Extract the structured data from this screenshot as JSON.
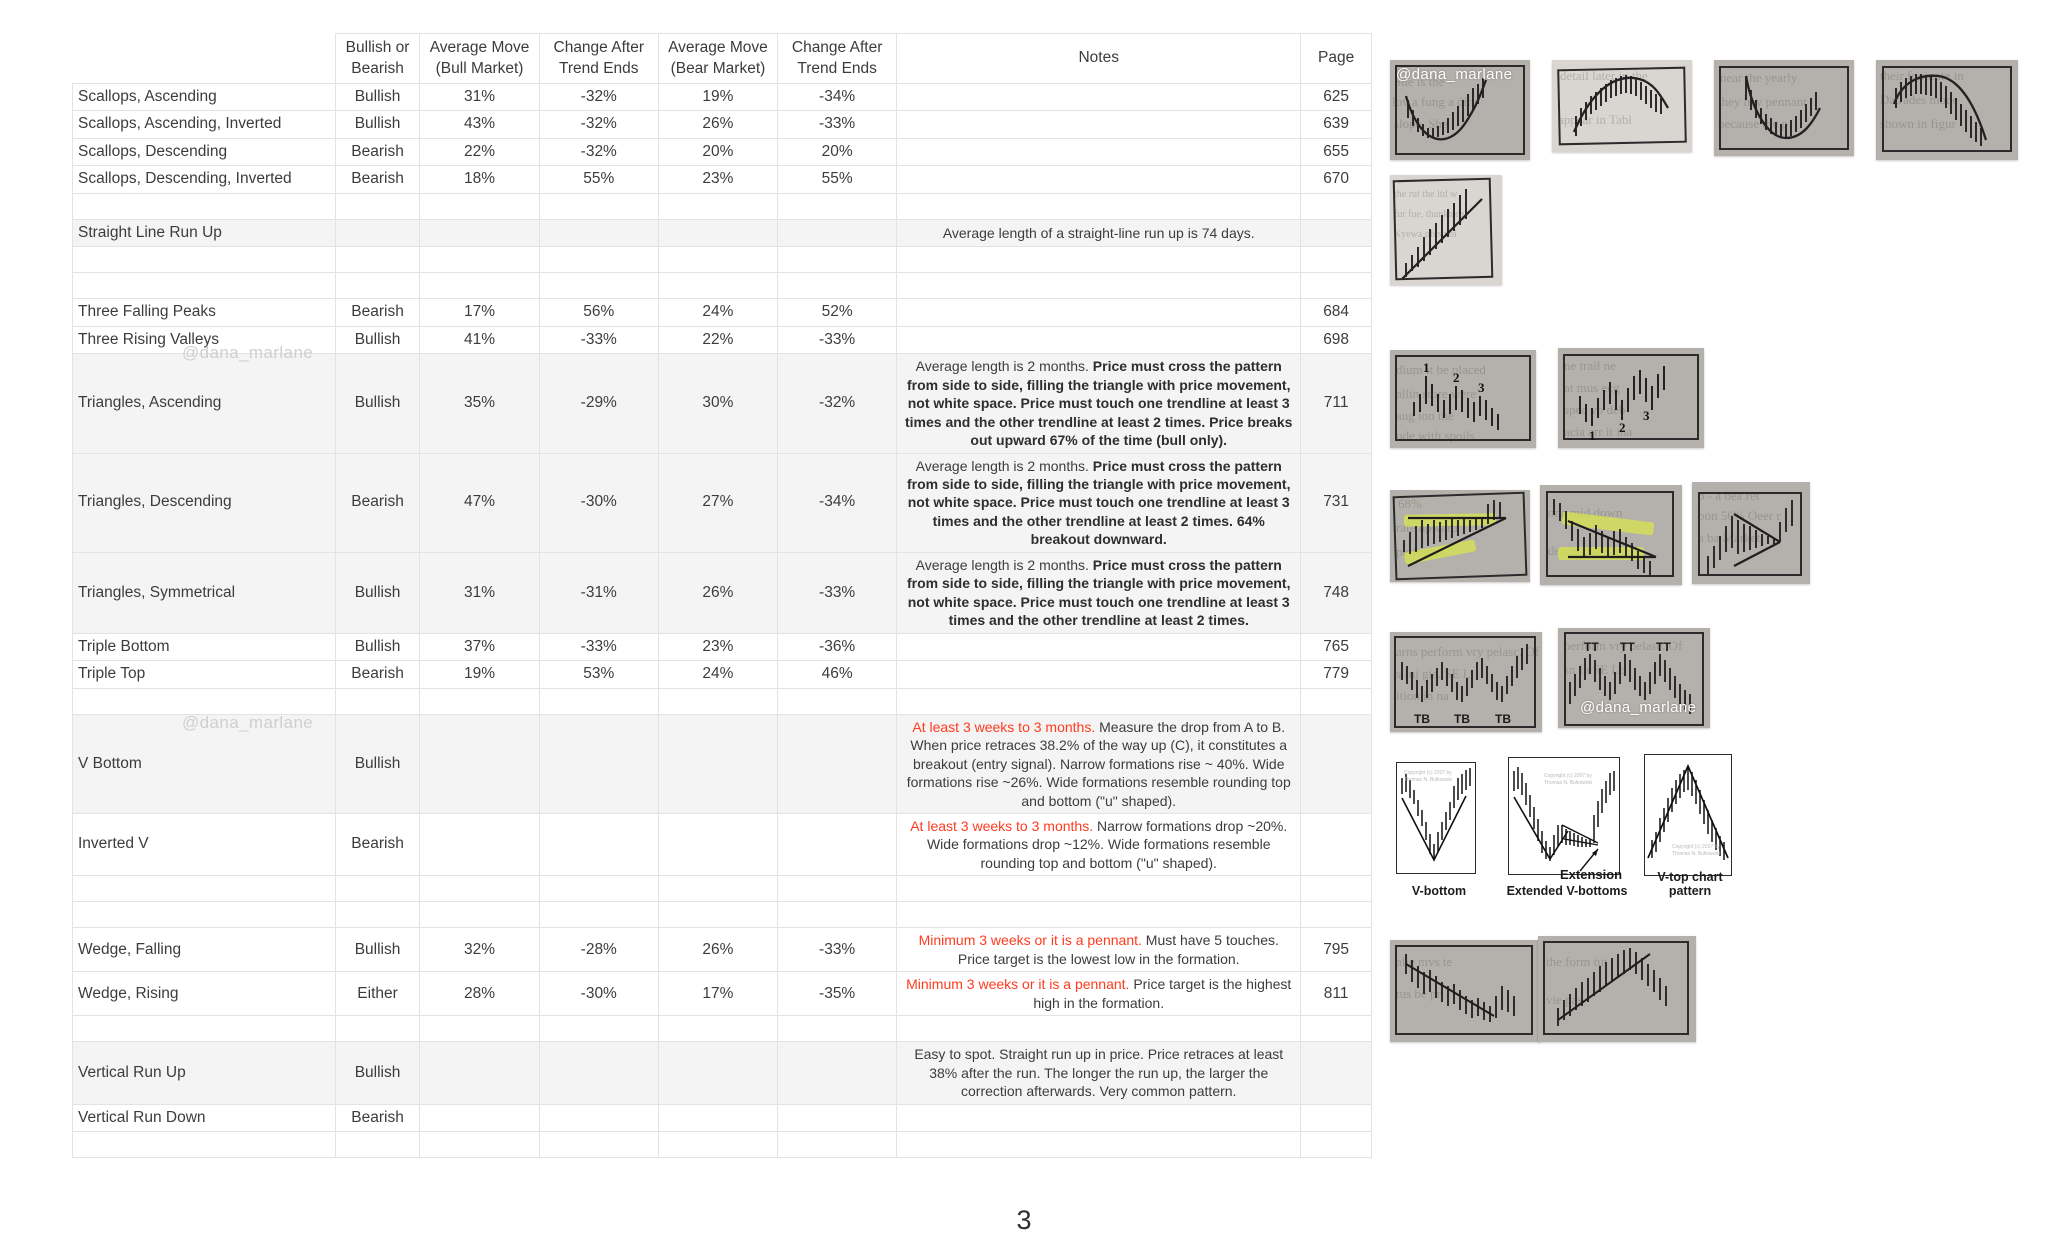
{
  "table": {
    "headers": [
      "",
      "Bullish or Bearish",
      "Average Move (Bull Market)",
      "Change After Trend Ends",
      "Average Move (Bear Market)",
      "Change After Trend Ends",
      "Notes",
      "Page"
    ],
    "headers_split": [
      {
        "l1": "",
        "l2": ""
      },
      {
        "l1": "Bullish or",
        "l2": "Bearish"
      },
      {
        "l1": "Average Move",
        "l2": "(Bull Market)"
      },
      {
        "l1": "Change After",
        "l2": "Trend Ends"
      },
      {
        "l1": "Average Move",
        "l2": "(Bear Market)"
      },
      {
        "l1": "Change After",
        "l2": "Trend Ends"
      },
      {
        "l1": "Notes",
        "l2": ""
      },
      {
        "l1": "Page",
        "l2": ""
      }
    ],
    "rows": [
      {
        "name": "Scallops, Ascending",
        "bb": "Bullish",
        "bull": "31%",
        "bull_end": "-32%",
        "bear": "19%",
        "bear_end": "-34%",
        "notes": "",
        "page": "625"
      },
      {
        "name": "Scallops, Ascending, Inverted",
        "bb": "Bullish",
        "bull": "43%",
        "bull_end": "-32%",
        "bear": "26%",
        "bear_end": "-33%",
        "notes": "",
        "page": "639"
      },
      {
        "name": "Scallops, Descending",
        "bb": "Bearish",
        "bull": "22%",
        "bull_end": "-32%",
        "bear": "20%",
        "bear_end": "20%",
        "notes": "",
        "page": "655"
      },
      {
        "name": "Scallops, Descending, Inverted",
        "bb": "Bearish",
        "bull": "18%",
        "bull_end": "55%",
        "bear": "23%",
        "bear_end": "55%",
        "notes": "",
        "page": "670"
      },
      {
        "name": "",
        "bb": "",
        "bull": "",
        "bull_end": "",
        "bear": "",
        "bear_end": "",
        "notes": "",
        "page": "",
        "blank": true
      },
      {
        "name": "Straight Line Run Up",
        "bb": "",
        "bull": "",
        "bull_end": "",
        "bear": "",
        "bear_end": "",
        "notes_plain": "Average length of a straight-line run up is 74 days.",
        "page": "",
        "shade": true
      },
      {
        "name": "",
        "bb": "",
        "bull": "",
        "bull_end": "",
        "bear": "",
        "bear_end": "",
        "notes": "",
        "page": "",
        "blank": true
      },
      {
        "name": "",
        "bb": "",
        "bull": "",
        "bull_end": "",
        "bear": "",
        "bear_end": "",
        "notes": "",
        "page": "",
        "blank": true
      },
      {
        "name": "Three Falling Peaks",
        "bb": "Bearish",
        "bull": "17%",
        "bull_end": "56%",
        "bear": "24%",
        "bear_end": "52%",
        "notes": "",
        "page": "684"
      },
      {
        "name": "Three Rising Valleys",
        "bb": "Bullish",
        "bull": "41%",
        "bull_end": "-33%",
        "bear": "22%",
        "bear_end": "-33%",
        "notes": "",
        "page": "698"
      },
      {
        "name": "Triangles, Ascending",
        "bb": "Bullish",
        "bull": "35%",
        "bull_end": "-29%",
        "bear": "30%",
        "bear_end": "-32%",
        "notes_plain": "Average length is 2 months. ",
        "notes_bold": "Price must cross the pattern from side to side, filling the triangle with price movement, not white space. Price must touch one trendline at least 3 times and the other trendline at least 2 times. Price breaks out upward 67% of the time (bull only).",
        "page": "711",
        "shade": true
      },
      {
        "name": "Triangles, Descending",
        "bb": "Bearish",
        "bull": "47%",
        "bull_end": "-30%",
        "bear": "27%",
        "bear_end": "-34%",
        "notes_plain": "Average length is 2 months. ",
        "notes_bold": "Price must cross the pattern from side to side, filling the triangle with price movement, not white space. Price must touch one trendline at least 3 times and the other trendline at least 2 times. 64% breakout downward.",
        "page": "731",
        "shade": true
      },
      {
        "name": "Triangles, Symmetrical",
        "bb": "Bullish",
        "bull": "31%",
        "bull_end": "-31%",
        "bear": "26%",
        "bear_end": "-33%",
        "notes_plain": "Average length is 2 months. ",
        "notes_bold": "Price must cross the pattern from side to side, filling the triangle with price movement, not white space. Price must touch one trendline at least 3 times and the other trendline at least 2 times.",
        "page": "748",
        "shade": true
      },
      {
        "name": "Triple Bottom",
        "bb": "Bullish",
        "bull": "37%",
        "bull_end": "-33%",
        "bear": "23%",
        "bear_end": "-36%",
        "notes": "",
        "page": "765"
      },
      {
        "name": "Triple Top",
        "bb": "Bearish",
        "bull": "19%",
        "bull_end": "53%",
        "bear": "24%",
        "bear_end": "46%",
        "notes": "",
        "page": "779"
      },
      {
        "name": "",
        "bb": "",
        "bull": "",
        "bull_end": "",
        "bear": "",
        "bear_end": "",
        "notes": "",
        "page": "",
        "blank": true
      },
      {
        "name": "V Bottom",
        "bb": "Bullish",
        "bull": "",
        "bull_end": "",
        "bear": "",
        "bear_end": "",
        "notes_red": "At least 3 weeks to 3 months.",
        "notes_rest": " Measure the drop from A to B. When price retraces 38.2% of the way up (C), it constitutes a breakout (entry signal). Narrow formations rise ~ 40%. Wide formations rise ~26%. Wide formations resemble rounding top and bottom (\"u\" shaped).",
        "page": "",
        "shade": true
      },
      {
        "name": "Inverted V",
        "bb": "Bearish",
        "bull": "",
        "bull_end": "",
        "bear": "",
        "bear_end": "",
        "notes_red": "At least 3 weeks to 3 months.",
        "notes_rest": " Narrow formations drop ~20%. Wide formations drop ~12%. Wide formations resemble rounding top and bottom (\"u\" shaped).",
        "page": ""
      },
      {
        "name": "",
        "bb": "",
        "bull": "",
        "bull_end": "",
        "bear": "",
        "bear_end": "",
        "notes": "",
        "page": "",
        "blank": true
      },
      {
        "name": "",
        "bb": "",
        "bull": "",
        "bull_end": "",
        "bear": "",
        "bear_end": "",
        "notes": "",
        "page": "",
        "blank": true
      },
      {
        "name": "Wedge, Falling",
        "bb": "Bullish",
        "bull": "32%",
        "bull_end": "-28%",
        "bear": "26%",
        "bear_end": "-33%",
        "notes_red": "Minimum 3 weeks or it is a pennant.",
        "notes_rest": " Must have 5 touches. Price target is the lowest low in the formation.",
        "page": "795"
      },
      {
        "name": "Wedge, Rising",
        "bb": "Either",
        "bull": "28%",
        "bull_end": "-30%",
        "bear": "17%",
        "bear_end": "-35%",
        "notes_red": "Minimum 3 weeks or it is a pennant.",
        "notes_rest": " Price target is the highest high in the formation.",
        "page": "811"
      },
      {
        "name": "",
        "bb": "",
        "bull": "",
        "bull_end": "",
        "bear": "",
        "bear_end": "",
        "notes": "",
        "page": "",
        "blank": true
      },
      {
        "name": "Vertical Run Up",
        "bb": "Bullish",
        "bull": "",
        "bull_end": "",
        "bear": "",
        "bear_end": "",
        "notes_plain": "Easy to spot. Straight run up in price. Price retraces at least 38% after the run. The longer the run up, the larger the correction afterwards. Very common pattern.",
        "page": "",
        "shade": true
      },
      {
        "name": "Vertical Run Down",
        "bb": "Bearish",
        "bull": "",
        "bull_end": "",
        "bear": "",
        "bear_end": "",
        "notes": "",
        "page": ""
      },
      {
        "name": "",
        "bb": "",
        "bull": "",
        "bull_end": "",
        "bear": "",
        "bear_end": "",
        "notes": "",
        "page": "",
        "blank": true
      }
    ]
  },
  "watermarks": {
    "table_1": "@dana_marlane",
    "table_2": "@dana_marlane",
    "photo_1": "@dana_marlane",
    "photo_2": "@dana_marlane"
  },
  "page_number": "3",
  "gallery": {
    "captions": {
      "v_bottom": "V-bottom",
      "extended_v": "Extended V-bottoms",
      "v_top": "V-top chart pattern",
      "extension": "Extension"
    },
    "markers": {
      "tb": "TB",
      "tt": "TT",
      "one": "1",
      "two": "2",
      "three": "3"
    },
    "copyright": "Copyright (c) 2007 by Thomas N. Bulkowski"
  },
  "colors": {
    "highlight_red": "#ff3b1f",
    "row_shade": "#f4f4f4",
    "grid": "#e3e3e3",
    "text": "#3c3c3c",
    "marker_yellow": "#dbe84a"
  }
}
